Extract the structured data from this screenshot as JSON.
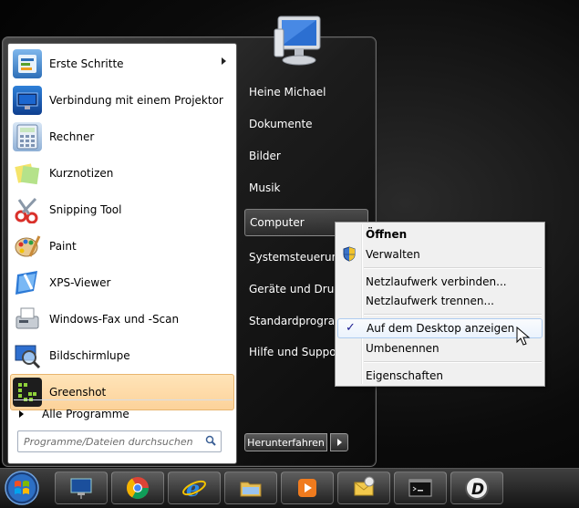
{
  "programs": [
    {
      "label": "Erste Schritte",
      "icon": "getting-started-icon",
      "has_submenu": true
    },
    {
      "label": "Verbindung mit einem Projektor",
      "icon": "projector-icon"
    },
    {
      "label": "Rechner",
      "icon": "calculator-icon"
    },
    {
      "label": "Kurznotizen",
      "icon": "sticky-notes-icon"
    },
    {
      "label": "Snipping Tool",
      "icon": "scissors-icon"
    },
    {
      "label": "Paint",
      "icon": "paint-palette-icon"
    },
    {
      "label": "XPS-Viewer",
      "icon": "xps-viewer-icon"
    },
    {
      "label": "Windows-Fax und -Scan",
      "icon": "fax-icon"
    },
    {
      "label": "Bildschirmlupe",
      "icon": "magnifier-icon"
    },
    {
      "label": "Greenshot",
      "icon": "greenshot-icon",
      "highlighted": true
    }
  ],
  "all_programs": {
    "label": "Alle Programme"
  },
  "search": {
    "placeholder": "Programme/Dateien durchsuchen"
  },
  "right_pane": {
    "items": [
      {
        "label": "Heine Michael"
      },
      {
        "label": "Dokumente"
      },
      {
        "label": "Bilder"
      },
      {
        "label": "Musik"
      },
      {
        "label": "Computer",
        "active": true
      },
      {
        "label": "Systemsteuerung"
      },
      {
        "label": "Geräte und Drucker"
      },
      {
        "label": "Standardprogramme"
      },
      {
        "label": "Hilfe und Support"
      }
    ],
    "shutdown_label": "Herunterfahren"
  },
  "context_menu": {
    "items": [
      {
        "label": "Öffnen",
        "bold": true
      },
      {
        "label": "Verwalten",
        "icon": "uac-shield-icon"
      },
      {
        "label": "Netzlaufwerk verbinden..."
      },
      {
        "label": "Netzlaufwerk trennen..."
      },
      {
        "label": "Auf dem Desktop anzeigen",
        "checked": true,
        "hover": true
      },
      {
        "label": "Umbenennen"
      },
      {
        "label": "Eigenschaften"
      }
    ],
    "check_glyph": "✓"
  },
  "taskbar": {
    "items": [
      "remote-desktop-icon",
      "chrome-icon",
      "internet-explorer-icon",
      "explorer-folder-icon",
      "media-player-icon",
      "outlook-icon",
      "cmd-icon",
      "daemon-tools-icon"
    ]
  },
  "colors": {
    "highlight": "#fcd29a",
    "menu_dark": "#1c1c1c",
    "context_bg": "#f0f0f0"
  }
}
